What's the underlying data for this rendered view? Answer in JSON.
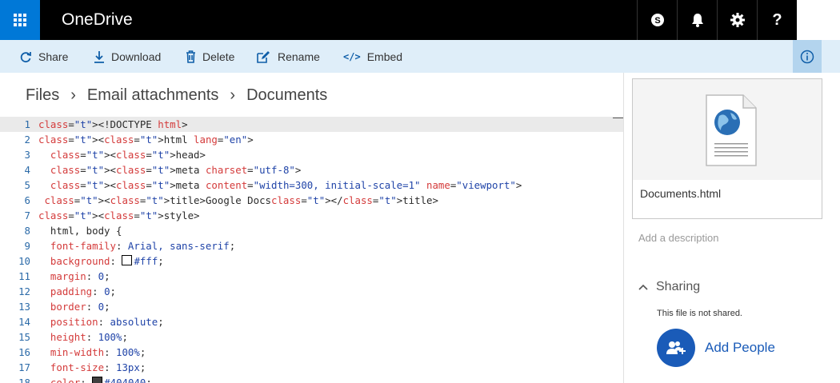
{
  "header": {
    "app_title": "OneDrive",
    "icons": [
      "waffle-icon",
      "skype-icon",
      "bell-icon",
      "gear-icon",
      "help-icon"
    ],
    "accent": "#0078d7"
  },
  "commands": {
    "share": "Share",
    "download": "Download",
    "delete": "Delete",
    "rename": "Rename",
    "embed": "Embed"
  },
  "breadcrumb": [
    "Files",
    "Email attachments",
    "Documents"
  ],
  "editor": {
    "lines": [
      {
        "n": "1",
        "code": "<!DOCTYPE html>"
      },
      {
        "n": "2",
        "code": "<html lang=\"en\">"
      },
      {
        "n": "3",
        "code": "  <head>"
      },
      {
        "n": "4",
        "code": "  <meta charset=\"utf-8\">"
      },
      {
        "n": "5",
        "code": "  <meta content=\"width=300, initial-scale=1\" name=\"viewport\">"
      },
      {
        "n": "6",
        "code": " <title>Google Docs</title>"
      },
      {
        "n": "7",
        "code": "<style>"
      },
      {
        "n": "8",
        "code": "  html, body {"
      },
      {
        "n": "9",
        "code": "  font-family: Arial, sans-serif;"
      },
      {
        "n": "10",
        "code": "  background: #fff;"
      },
      {
        "n": "11",
        "code": "  margin: 0;"
      },
      {
        "n": "12",
        "code": "  padding: 0;"
      },
      {
        "n": "13",
        "code": "  border: 0;"
      },
      {
        "n": "14",
        "code": "  position: absolute;"
      },
      {
        "n": "15",
        "code": "  height: 100%;"
      },
      {
        "n": "16",
        "code": "  min-width: 100%;"
      },
      {
        "n": "17",
        "code": "  font-size: 13px;"
      },
      {
        "n": "18",
        "code": "  color: #404040;"
      }
    ]
  },
  "details": {
    "file_name": "Documents.html",
    "description_placeholder": "Add a description",
    "sharing_title": "Sharing",
    "sharing_status": "This file is not shared.",
    "add_people": "Add People"
  }
}
